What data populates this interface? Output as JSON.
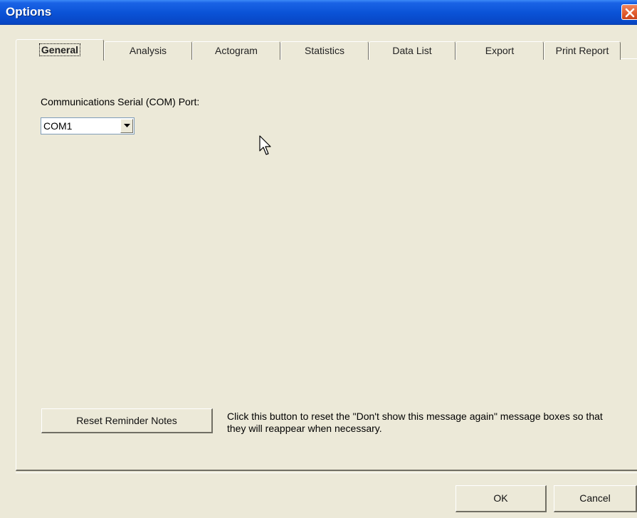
{
  "window": {
    "title": "Options"
  },
  "tabs": [
    {
      "label": "General",
      "active": true
    },
    {
      "label": "Analysis",
      "active": false
    },
    {
      "label": "Actogram",
      "active": false
    },
    {
      "label": "Statistics",
      "active": false
    },
    {
      "label": "Data List",
      "active": false
    },
    {
      "label": "Export",
      "active": false
    },
    {
      "label": "Print Report",
      "active": false
    }
  ],
  "general": {
    "com_port_label": "Communications Serial (COM) Port:",
    "com_port_value": "COM1",
    "reset_button_label": "Reset Reminder Notes",
    "reset_note": "Click this button to reset the \"Don't show this message again\" message boxes so that they will reappear when necessary."
  },
  "footer": {
    "ok_label": "OK",
    "cancel_label": "Cancel"
  },
  "colors": {
    "titlebar": "#0a52d6",
    "dialog_bg": "#ece9d8",
    "close": "#e05a2c"
  }
}
